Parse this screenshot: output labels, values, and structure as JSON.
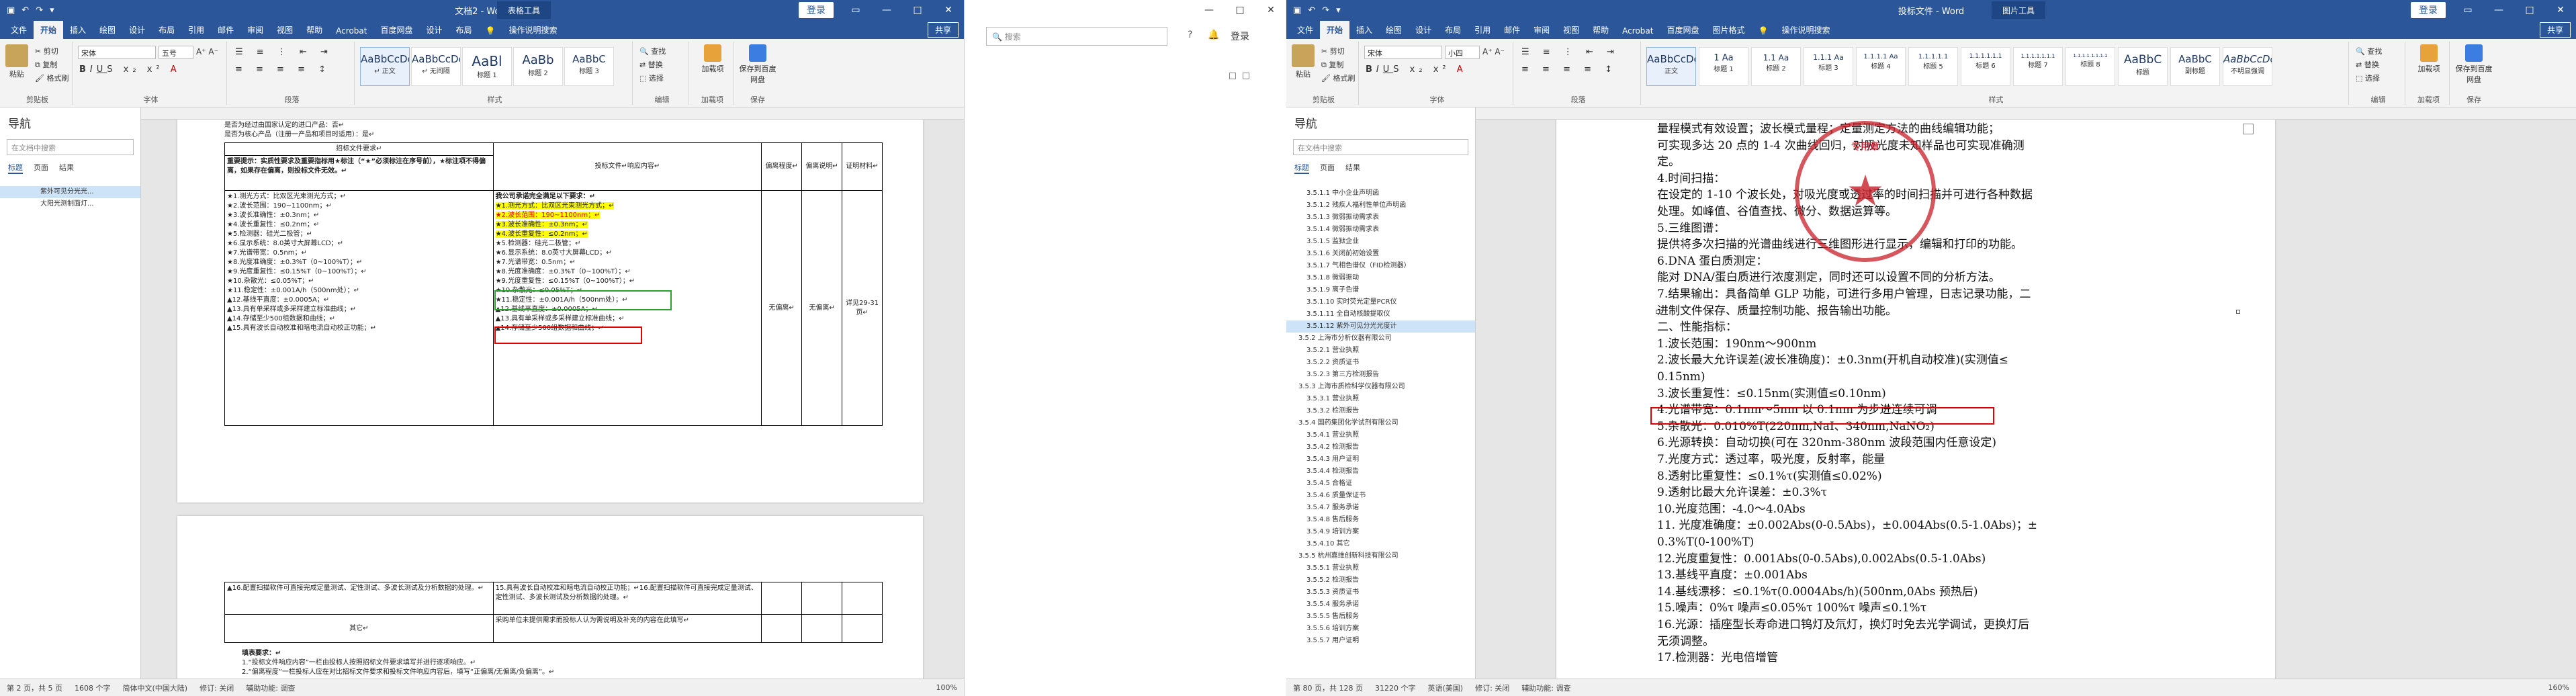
{
  "win1": {
    "title": "文档2 - Word",
    "context_tab": "表格工具",
    "login": "登录",
    "tabs": [
      "文件",
      "开始",
      "插入",
      "绘图",
      "设计",
      "布局",
      "引用",
      "邮件",
      "审阅",
      "视图",
      "帮助",
      "Acrobat",
      "百度网盘",
      "设计",
      "布局"
    ],
    "tell_me": "操作说明搜索",
    "share": "共享",
    "clipboard": {
      "paste": "粘贴",
      "cut": "剪切",
      "copy": "复制",
      "painter": "格式刷",
      "group": "剪贴板"
    },
    "font": {
      "name": "宋体",
      "size": "五号",
      "group": "字体"
    },
    "paragraph_group": "段落",
    "styles": [
      {
        "preview": "AaBbCcDc",
        "name": "↵ 正文"
      },
      {
        "preview": "AaBbCcDc",
        "name": "↵ 无间隔"
      },
      {
        "preview": "AaBl",
        "name": "标题 1"
      },
      {
        "preview": "AaBb",
        "name": "标题 2"
      },
      {
        "preview": "AaBbC",
        "name": "标题 3"
      }
    ],
    "styles_group": "样式",
    "editing": {
      "find": "查找",
      "replace": "替换",
      "select": "选择",
      "group": "编辑"
    },
    "addin": {
      "label": "加载项",
      "group": "加载项"
    },
    "save_baidu": {
      "label": "保存到百度网盘",
      "group": "保存"
    },
    "nav": {
      "title": "导航",
      "search_placeholder": "在文档中搜索",
      "tabs": [
        "标题",
        "页面",
        "结果"
      ],
      "items": [
        "紫外可见分光光...",
        "大阳光测制面灯..."
      ]
    },
    "doc_top": {
      "line1": "是否为经过由国家认定的进口产品：否↵",
      "line2": "是否为核心产品（注册一产品和项目时适用）：是↵"
    },
    "table": {
      "hdr_req": "招标文件要求↵",
      "hdr_resp": "投标文件↵响应内容↵",
      "hdr_dev": "偏离程度↵",
      "hdr_note": "偏离说明↵",
      "hdr_proof": "证明材料↵",
      "intro": "重要提示：实质性要求及重要指标用★标注（“★”必须标注在序号前），★标注项不得偏离，如果存在偏离，则投标文件无效。↵",
      "req_lines": [
        "★1.测光方式：比双区光束测光方式；↵",
        "★2.波长范围：190~1100nm；↵",
        "★3.波长准确性：±0.3nm；↵",
        "★4.波长重复性：≤0.2nm；↵",
        "★5.检测器：硅光二极管；↵",
        "★6.显示系统：8.0英寸大屏幕LCD；↵",
        "★7.光谱带宽：0.5nm；↵",
        "★8.光度准确度：±0.3%T（0~100%T）；↵",
        "★9.光度重复性：≤0.15%T（0~100%T）；↵",
        "★10.杂散光：≤0.05%T；↵",
        "★11.稳定性：±0.001A/h（500nm处）；↵",
        "▲12.基线平直度：±0.0005A；↵",
        "▲13.具有单采样或多采样建立标准曲线；↵",
        "▲14.存储至少500组数据和曲线；↵",
        "▲15.具有波长自动校准和暗电流自动校正功能；↵"
      ],
      "resp_title": "我公司承诺完全满足以下要求：↵",
      "resp_lines": [
        "★1.测光方式：比双区光束测光方式；↵",
        "★2.波长范围：190~1100nm；↵",
        "★3.波长准确性：±0.3nm；↵",
        "★4.波长重复性：≤0.2nm；↵",
        "★5.检测器：硅光二极管；↵",
        "★6.显示系统：8.0英寸大屏幕LCD；↵",
        "★7.光谱带宽：0.5nm；↵",
        "★8.光度准确度：±0.3%T（0~100%T）；↵",
        "★9.光度重复性：≤0.15%T（0~100%T）；↵",
        "★10.杂散光：≤0.05%T；↵",
        "★11.稳定性：±0.001A/h（500nm处）；↵",
        "▲12.基线平直度：±0.0005A；↵",
        "▲13.具有单采样或多采样建立标准曲线；↵",
        "▲14.存储至少500组数据和曲线；↵"
      ],
      "dev": "无偏离↵",
      "note": "无偏离↵",
      "proof": "详见29-31页↵",
      "row2_req": "▲16.配置扫描软件可直接完成定量测试、定性测试、多波长测试及分析数据的处理。↵",
      "row2_resp": "15.具有波长自动校准和暗电流自动校正功能；↵16.配置扫描软件可直接完成定量测试、定性测试、多波长测试及分析数据的处理。↵",
      "other_label": "其它↵",
      "other_resp": "采购单位未提供需求而投标人认为需说明及补充的内容在此填写↵",
      "footer_title": "填表要求：↵",
      "footer_lines": [
        "1.“投标文件响应内容”一栏由投标人按照招标文件要求填写并进行逐项响应。↵",
        "2.“偏离程度”一栏投标人应在对比招标文件要求和投标文件响应内容后，填写“正偏离/无偏离/负偏离”。↵"
      ]
    },
    "status": {
      "page": "第 2 页，共 5 页",
      "words": "1608 个字",
      "lang": "简体中文(中国大陆)",
      "track": "修订: 关闭",
      "access": "辅助功能: 调查",
      "zoom": "100%"
    }
  },
  "win2": {
    "search_placeholder": "搜索",
    "login": "登录"
  },
  "win3": {
    "title": "投标文件 - Word",
    "context_tab": "图片工具",
    "login": "登录",
    "tabs": [
      "文件",
      "开始",
      "插入",
      "绘图",
      "设计",
      "布局",
      "引用",
      "邮件",
      "审阅",
      "视图",
      "帮助",
      "Acrobat",
      "百度网盘",
      "图片格式"
    ],
    "tell_me": "操作说明搜索",
    "share": "共享",
    "clipboard": {
      "paste": "粘贴",
      "cut": "剪切",
      "copy": "复制",
      "painter": "格式刷",
      "group": "剪贴板"
    },
    "font": {
      "name": "宋体",
      "size": "小四",
      "group": "字体"
    },
    "paragraph_group": "段落",
    "styles": [
      {
        "preview": "AaBbCcDc",
        "name": "正文"
      },
      {
        "preview": "1 Aa",
        "name": "标题 1"
      },
      {
        "preview": "1.1 Aa",
        "name": "标题 2"
      },
      {
        "preview": "1.1.1 Aa",
        "name": "标题 3"
      },
      {
        "preview": "1.1.1.1 Aa",
        "name": "标题 4"
      },
      {
        "preview": "1.1.1.1.1",
        "name": "标题 5"
      },
      {
        "preview": "1.1.1.1.1.1",
        "name": "标题 6"
      },
      {
        "preview": "1.1.1.1.1.1.1",
        "name": "标题 7"
      },
      {
        "preview": "1.1.1.1.1.1.1.1",
        "name": "标题 8"
      },
      {
        "preview": "AaBbC",
        "name": "标题"
      },
      {
        "preview": "AaBbC",
        "name": "副标题"
      },
      {
        "preview": "AaBbCcDc",
        "name": "不明显强调"
      }
    ],
    "styles_group": "样式",
    "editing": {
      "find": "查找",
      "replace": "替换",
      "select": "选择",
      "group": "编辑"
    },
    "addin": {
      "label": "加载项",
      "group": "加载项"
    },
    "save_baidu": {
      "label": "保存到百度网盘",
      "group": "保存"
    },
    "nav": {
      "title": "导航",
      "search_placeholder": "在文档中搜索",
      "tabs": [
        "标题",
        "页面",
        "结果"
      ],
      "items": [
        {
          "t": "3.5.1.1 中小企业声明函",
          "l": 2
        },
        {
          "t": "3.5.1.2 残疾人福利性单位声明函",
          "l": 2
        },
        {
          "t": "3.5.1.3 微弱振动需求表",
          "l": 2
        },
        {
          "t": "3.5.1.4 微弱振动需求表",
          "l": 2
        },
        {
          "t": "3.5.1.5 监狱企业",
          "l": 2
        },
        {
          "t": "3.5.1.6 关闭前初始设置",
          "l": 2
        },
        {
          "t": "3.5.1.7 气相色谱仪（FID检测器）",
          "l": 2
        },
        {
          "t": "3.5.1.8 微弱振动",
          "l": 2
        },
        {
          "t": "3.5.1.9 离子色谱",
          "l": 2
        },
        {
          "t": "3.5.1.10 实时荧光定量PCR仪",
          "l": 2
        },
        {
          "t": "3.5.1.11 全自动核酸提取仪",
          "l": 2
        },
        {
          "t": "3.5.1.12 紫外可见分光光度计",
          "l": 2,
          "sel": true
        },
        {
          "t": "3.5.2 上海市分析仪器有限公司",
          "l": 1
        },
        {
          "t": "3.5.2.1 营业执照",
          "l": 2
        },
        {
          "t": "3.5.2.2 资质证书",
          "l": 2
        },
        {
          "t": "3.5.2.3 第三方检测报告",
          "l": 2
        },
        {
          "t": "3.5.3 上海市质检科学仪器有限公司",
          "l": 1
        },
        {
          "t": "3.5.3.1 营业执照",
          "l": 2
        },
        {
          "t": "3.5.3.2 检测报告",
          "l": 2
        },
        {
          "t": "3.5.4 国药集团化学试剂有限公司",
          "l": 1
        },
        {
          "t": "3.5.4.1 营业执照",
          "l": 2
        },
        {
          "t": "3.5.4.2 检测报告",
          "l": 2
        },
        {
          "t": "3.5.4.3 用户证明",
          "l": 2
        },
        {
          "t": "3.5.4.4 检测报告",
          "l": 2
        },
        {
          "t": "3.5.4.5 合格证",
          "l": 2
        },
        {
          "t": "3.5.4.6 质量保证书",
          "l": 2
        },
        {
          "t": "3.5.4.7 服务承诺",
          "l": 2
        },
        {
          "t": "3.5.4.8 售后服务",
          "l": 2
        },
        {
          "t": "3.5.4.9 培训方案",
          "l": 2
        },
        {
          "t": "3.5.4.10 其它",
          "l": 2
        },
        {
          "t": "3.5.5 杭州嘉维创新科技有限公司",
          "l": 1
        },
        {
          "t": "3.5.5.1 营业执照",
          "l": 2
        },
        {
          "t": "3.5.5.2 检测报告",
          "l": 2
        },
        {
          "t": "3.5.5.3 资质证书",
          "l": 2
        },
        {
          "t": "3.5.5.4 服务承诺",
          "l": 2
        },
        {
          "t": "3.5.5.5 售后服务",
          "l": 2
        },
        {
          "t": "3.5.5.6 培训方案",
          "l": 2
        },
        {
          "t": "3.5.5.7 用户证明",
          "l": 2
        }
      ]
    },
    "doc_lines": [
      "量程模式有效设置；波长模式量程；定量测定方法的曲线编辑功能；",
      "可实现多达 20 点的 1-4 次曲线回归，对吸光度未知样品也可实现准确测",
      "定。",
      "4.时间扫描：",
      "在设定的 1-10 个波长处，对吸光度或透过率的时间扫描并可进行各种数据",
      "处理。如峰值、谷值查找、微分、数据运算等。",
      "5.三维图谱：",
      "提供将多次扫描的光谱曲线进行三维图形进行显示，编辑和打印的功能。",
      "6.DNA 蛋白质测定：",
      "能对 DNA/蛋白质进行浓度测定，同时还可以设置不同的分析方法。",
      "7.结果输出：具备简单 GLP 功能，可进行多用户管理，日志记录功能，二",
      "进制文件保存、质量控制功能、报告输出功能。",
      "二、性能指标：",
      "1.波长范围：190nm～900nm",
      "2.波长最大允许误差(波长准确度)：±0.3nm(开机自动校准)(实测值≤",
      "0.15nm)",
      "3.波长重复性：≤0.15nm(实测值≤0.10nm)",
      "4.光谱带宽：0.1nm～5nm 以 0.1nm 为步进连续可调",
      "5.杂散光：0.010%T(220nm,NaI、340nm,NaNO₂)",
      "6.光源转换：自动切换(可在 320nm-380nm 波段范围内任意设定)",
      "7.光度方式：透过率，吸光度，反射率，能量",
      "8.透射比重复性：≤0.1%τ(实测值≤0.02%)",
      "9.透射比最大允许误差：±0.3%τ",
      "10.光度范围：-4.0～4.0Abs",
      "11. 光度准确度：±0.002Abs(0-0.5Abs)，±0.004Abs(0.5-1.0Abs)；±",
      "0.3%T(0-100%T)",
      "12.光度重复性：0.001Abs(0-0.5Abs),0.002Abs(0.5-1.0Abs)",
      "13.基线平直度：±0.001Abs",
      "14.基线漂移：≤0.1%τ(0.0004Abs/h)(500nm,0Abs 预热后)",
      "15.噪声：0%τ 噪声≤0.05%τ 100%τ 噪声≤0.1%τ",
      "16.光源：插座型长寿命进口钨灯及氘灯，换灯时免去光学调试，更换灯后",
      "无须调整。",
      "17.检测器：光电倍增管"
    ],
    "seal_text": "专用章",
    "status": {
      "page": "第 80 页，共 128 页",
      "words": "31220 个字",
      "lang": "英语(美国)",
      "track": "修订: 关闭",
      "access": "辅助功能: 调查",
      "zoom": "160%"
    }
  }
}
